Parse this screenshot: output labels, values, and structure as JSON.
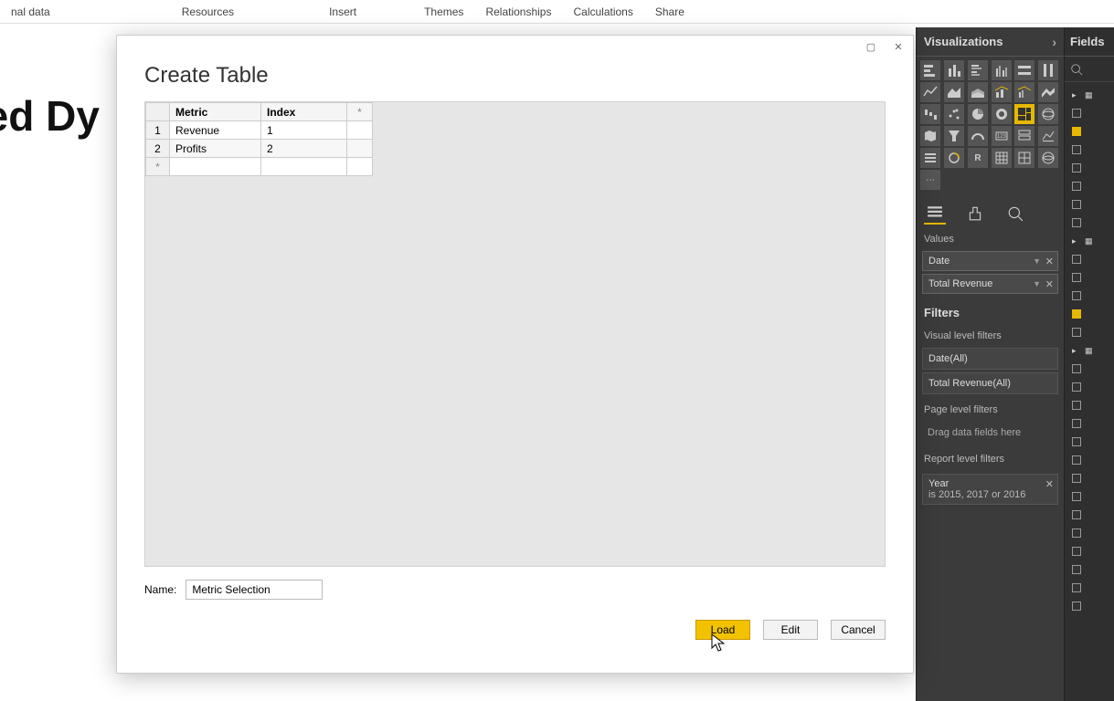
{
  "ribbon": {
    "tabs": [
      "nal data",
      "Resources",
      "Insert",
      "Themes",
      "Relationships",
      "Calculations",
      "Share"
    ]
  },
  "background_title": "aded Dy",
  "viz": {
    "header": "Visualizations",
    "tabs_section_label": "Values",
    "value_fields": [
      {
        "label": "Date"
      },
      {
        "label": "Total Revenue"
      }
    ],
    "filters_header": "Filters",
    "visual_filters_label": "Visual level filters",
    "visual_filters": [
      {
        "label": "Date(All)"
      },
      {
        "label": "Total Revenue(All)"
      }
    ],
    "page_filters_label": "Page level filters",
    "drag_hint": "Drag data fields here",
    "report_filters_label": "Report level filters",
    "year_filter": {
      "title": "Year",
      "desc": "is 2015, 2017 or 2016"
    }
  },
  "fields": {
    "header": "Fields",
    "search_placeholder": "Search"
  },
  "dialog": {
    "title": "Create Table",
    "columns": [
      "Metric",
      "Index"
    ],
    "rows": [
      {
        "n": "1",
        "metric": "Revenue",
        "index": "1"
      },
      {
        "n": "2",
        "metric": "Profits",
        "index": "2"
      }
    ],
    "star": "*",
    "name_label": "Name:",
    "name_value": "Metric Selection",
    "buttons": {
      "load": "Load",
      "edit": "Edit",
      "cancel": "Cancel"
    }
  }
}
